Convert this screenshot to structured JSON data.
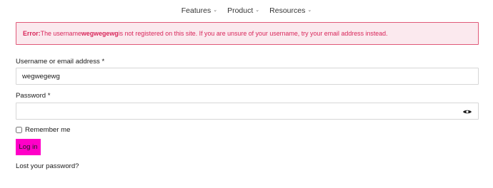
{
  "nav": {
    "items": [
      {
        "label": "Features"
      },
      {
        "label": "Product"
      },
      {
        "label": "Resources"
      }
    ],
    "chevron": "⌄"
  },
  "error": {
    "prefix": "Error:",
    "text_before": " The username ",
    "username": "wegwegewg",
    "text_after": " is not registered on this site. If you are unsure of your username, try your email address instead.",
    "colors": {
      "text": "#d8265a",
      "border": "#e05a79",
      "background": "#fbe9ee"
    }
  },
  "form": {
    "username_label": "Username or email address *",
    "username_value": "wegwegewg",
    "password_label": "Password *",
    "password_value": "",
    "show_password_icon": "eye-icon",
    "remember_label": "Remember me",
    "remember_checked": false,
    "login_label": "Log in",
    "login_color": "#ff00c8",
    "lost_password_label": "Lost your password?"
  }
}
